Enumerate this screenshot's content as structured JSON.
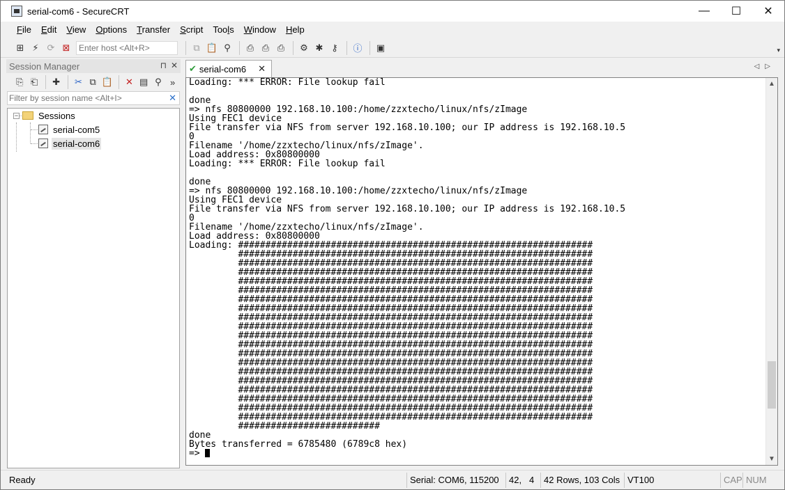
{
  "window": {
    "title": "serial-com6 - SecureCRT",
    "minimize": "—",
    "maximize": "☐",
    "close": "✕"
  },
  "menu": [
    {
      "label": "File",
      "key": "F",
      "rest": "ile"
    },
    {
      "label": "Edit",
      "key": "E",
      "rest": "dit"
    },
    {
      "label": "View",
      "key": "V",
      "rest": "iew"
    },
    {
      "label": "Options",
      "key": "O",
      "rest": "ptions"
    },
    {
      "label": "Transfer",
      "key": "T",
      "rest": "ransfer"
    },
    {
      "label": "Script",
      "key": "S",
      "rest": "cript"
    },
    {
      "label": "Tools",
      "pre": "Too",
      "key": "l",
      "rest": "s"
    },
    {
      "label": "Window",
      "key": "W",
      "rest": "indow"
    },
    {
      "label": "Help",
      "key": "H",
      "rest": "elp"
    }
  ],
  "toolbar": {
    "host_placeholder": "Enter host <Alt+R>"
  },
  "session_manager": {
    "title": "Session Manager",
    "pin": "⊓",
    "close": "✕",
    "more": "»",
    "filter_placeholder": "Filter by session name <Alt+I>",
    "filter_clear": "✕",
    "root": "Sessions",
    "expander": "−",
    "sessions": [
      "serial-com5",
      "serial-com6"
    ],
    "selected": "serial-com6"
  },
  "tabs": {
    "active_label": "serial-com6",
    "status_icon": "✔",
    "close": "✕",
    "nav": "◁▷"
  },
  "terminal": {
    "lines": [
      "Loading: *** ERROR: File lookup fail",
      "",
      "done",
      "=> nfs 80800000 192.168.10.100:/home/zzxtecho/linux/nfs/zImage",
      "Using FEC1 device",
      "File transfer via NFS from server 192.168.10.100; our IP address is 192.168.10.5",
      "0",
      "Filename '/home/zzxtecho/linux/nfs/zImage'.",
      "Load address: 0x80800000",
      "Loading: *** ERROR: File lookup fail",
      "",
      "done",
      "=> nfs 80800000 192.168.10.100:/home/zzxtecho/linux/nfs/zImage",
      "Using FEC1 device",
      "File transfer via NFS from server 192.168.10.100; our IP address is 192.168.10.5",
      "0",
      "Filename '/home/zzxtecho/linux/nfs/zImage'.",
      "Load address: 0x80800000",
      "Loading: #################################################################",
      "         #################################################################",
      "         #################################################################",
      "         #################################################################",
      "         #################################################################",
      "         #################################################################",
      "         #################################################################",
      "         #################################################################",
      "         #################################################################",
      "         #################################################################",
      "         #################################################################",
      "         #################################################################",
      "         #################################################################",
      "         #################################################################",
      "         #################################################################",
      "         #################################################################",
      "         #################################################################",
      "         #################################################################",
      "         #################################################################",
      "         #################################################################",
      "         ##########################",
      "done",
      "Bytes transferred = 6785480 (6789c8 hex)",
      "=> "
    ],
    "scroll_position": 0.86,
    "scroll_visible_fraction": 0.13
  },
  "statusbar": {
    "ready": "Ready",
    "connection": "Serial: COM6, 115200",
    "cursor_row": "42,",
    "cursor_col": "4",
    "dimensions": "42 Rows, 103 Cols",
    "emulation": "VT100",
    "cap": "CAP",
    "num": "NUM"
  }
}
